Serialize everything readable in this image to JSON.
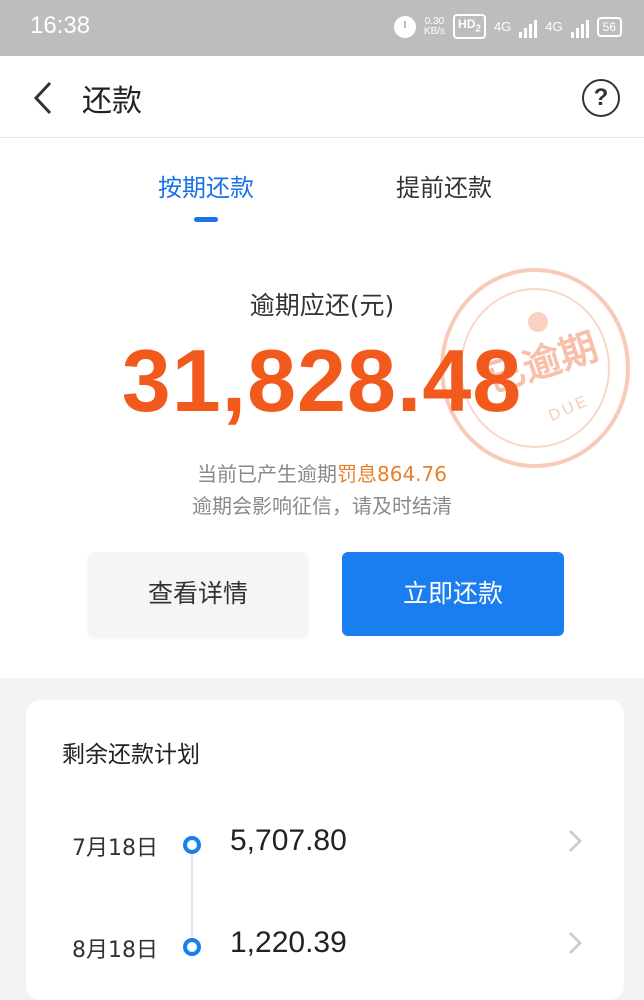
{
  "status_bar": {
    "time": "16:38",
    "net_speed_value": "0.30",
    "net_speed_unit": "KB/s",
    "hd_label": "HD",
    "hd_sub": "2",
    "net1": "4G",
    "net2": "4G",
    "battery": "56"
  },
  "nav": {
    "title": "还款",
    "help": "?"
  },
  "tabs": [
    {
      "label": "按期还款",
      "active": true
    },
    {
      "label": "提前还款",
      "active": false
    }
  ],
  "overdue": {
    "label": "逾期应还(元)",
    "amount": "31,828.48",
    "penalty_prefix": "当前已产生逾期",
    "penalty_highlight": "罚息864.76",
    "warning": "逾期会影响征信，请及时结清",
    "stamp_text": "已逾期",
    "stamp_sub": "DUE"
  },
  "buttons": {
    "detail": "查看详情",
    "pay": "立即还款"
  },
  "plan": {
    "title": "剩余还款计划",
    "rows": [
      {
        "date": "7月18日",
        "amount": "5,707.80"
      },
      {
        "date": "8月18日",
        "amount": "1,220.39"
      }
    ]
  },
  "colors": {
    "accent": "#1a7df0",
    "amount": "#f25a1d",
    "penalty": "#e8812a"
  }
}
